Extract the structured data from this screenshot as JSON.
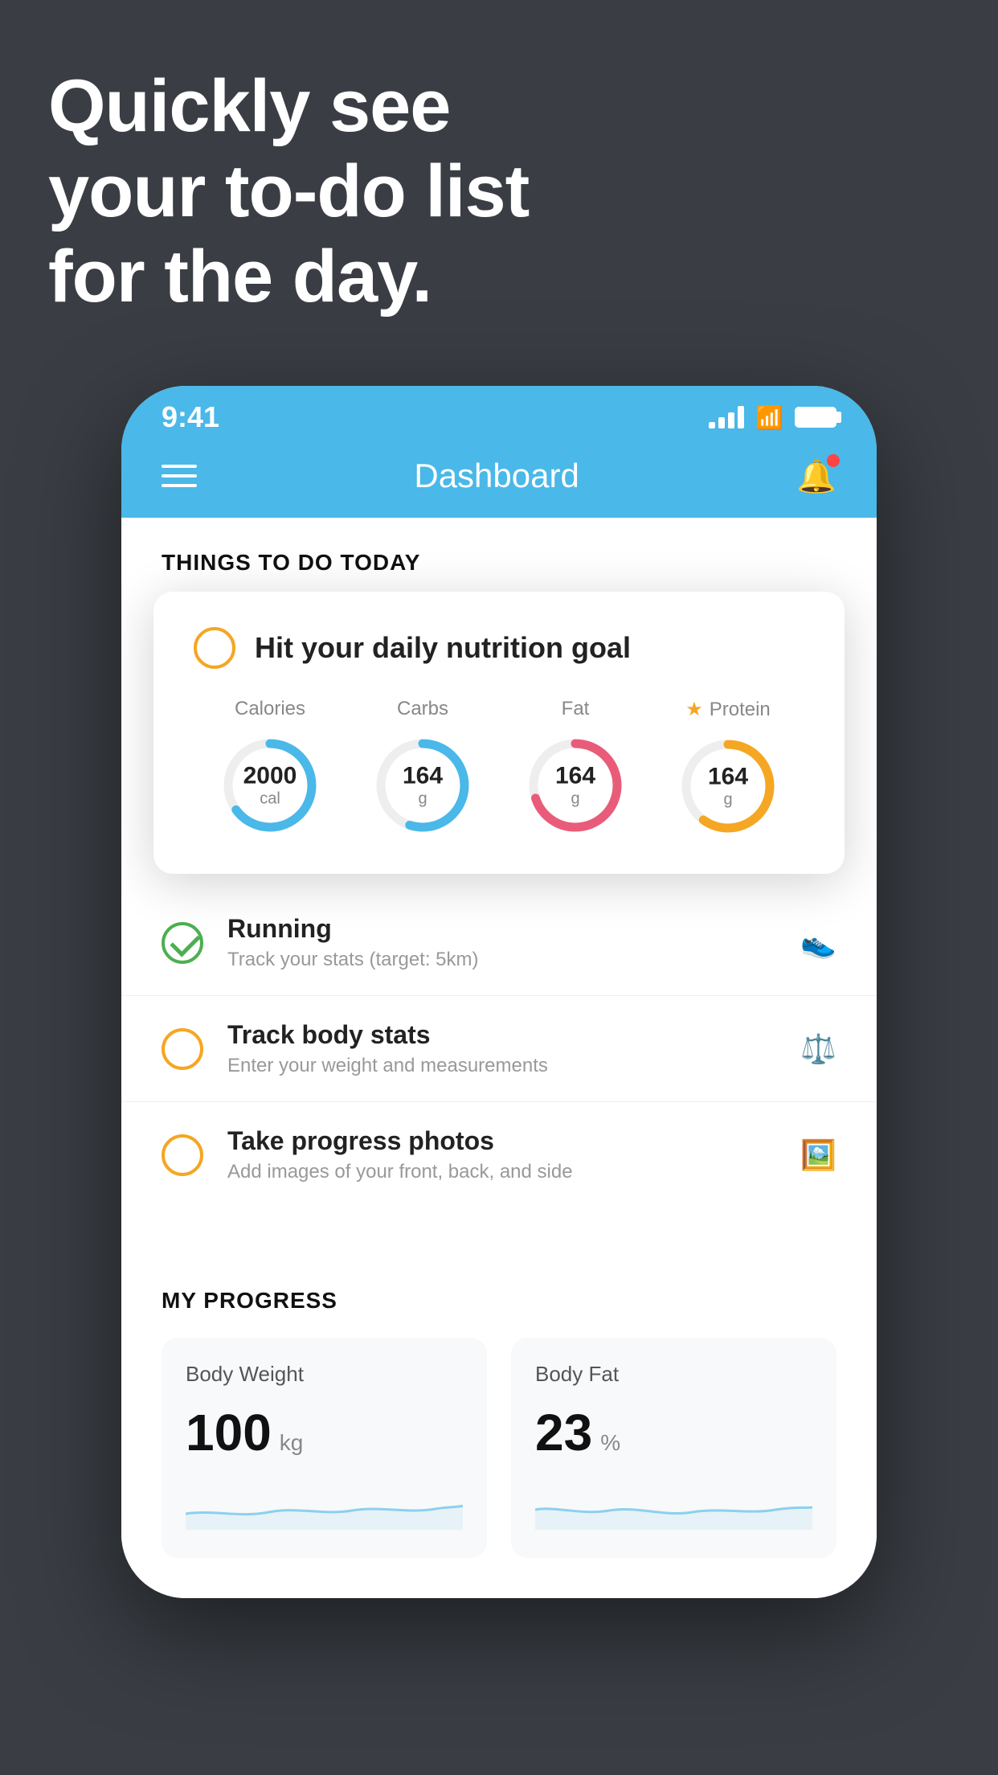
{
  "headline": {
    "line1": "Quickly see",
    "line2": "your to-do list",
    "line3": "for the day."
  },
  "statusBar": {
    "time": "9:41"
  },
  "header": {
    "title": "Dashboard"
  },
  "thingsToDo": {
    "sectionLabel": "THINGS TO DO TODAY"
  },
  "nutritionCard": {
    "checkLabel": "Hit your daily nutrition goal",
    "items": [
      {
        "label": "Calories",
        "value": "2000",
        "unit": "cal",
        "color": "#4ab8e8",
        "pct": 65,
        "hasStar": false
      },
      {
        "label": "Carbs",
        "value": "164",
        "unit": "g",
        "color": "#4ab8e8",
        "pct": 55,
        "hasStar": false
      },
      {
        "label": "Fat",
        "value": "164",
        "unit": "g",
        "color": "#e85c7a",
        "pct": 70,
        "hasStar": false
      },
      {
        "label": "Protein",
        "value": "164",
        "unit": "g",
        "color": "#f5a623",
        "pct": 60,
        "hasStar": true
      }
    ]
  },
  "todoItems": [
    {
      "type": "checked",
      "title": "Running",
      "subtitle": "Track your stats (target: 5km)",
      "icon": "shoe"
    },
    {
      "type": "empty",
      "title": "Track body stats",
      "subtitle": "Enter your weight and measurements",
      "icon": "scale"
    },
    {
      "type": "empty",
      "title": "Take progress photos",
      "subtitle": "Add images of your front, back, and side",
      "icon": "photo"
    }
  ],
  "progress": {
    "sectionLabel": "MY PROGRESS",
    "cards": [
      {
        "title": "Body Weight",
        "value": "100",
        "unit": "kg"
      },
      {
        "title": "Body Fat",
        "value": "23",
        "unit": "%"
      }
    ]
  }
}
